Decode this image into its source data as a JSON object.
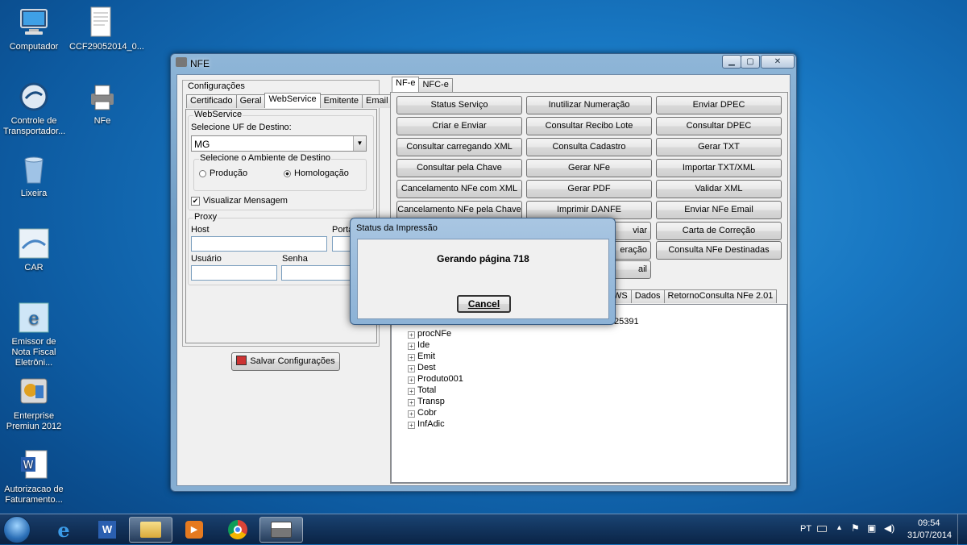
{
  "desktop": {
    "icons": [
      {
        "label": "Computador",
        "icon": "computer-icon"
      },
      {
        "label": "CCF29052014_0...",
        "icon": "document-icon"
      },
      {
        "label": "Controle de Transportador...",
        "icon": "app-icon"
      },
      {
        "label": "NFe",
        "icon": "printer-icon"
      },
      {
        "label": "Lixeira",
        "icon": "recycle-bin-icon"
      },
      {
        "label": "CAR",
        "icon": "car-app-icon"
      },
      {
        "label": "Emissor de Nota Fiscal Eletrôni...",
        "icon": "nfe-emissor-icon"
      },
      {
        "label": "Enterprise Premiun 2012",
        "icon": "enterprise-icon"
      },
      {
        "label": "Autorizacao de Faturamento...",
        "icon": "word-document-icon"
      }
    ]
  },
  "window": {
    "title": "NFE",
    "left": {
      "group_label": "Configurações",
      "tabs": [
        "Certificado",
        "Geral",
        "WebService",
        "Emitente",
        "Email"
      ],
      "active_tab": "WebService",
      "webservice": {
        "legend": "WebService",
        "uf_label": "Selecione UF de Destino:",
        "uf_value": "MG",
        "ambiente_legend": "Selecione o Ambiente de Destino",
        "producao": "Produção",
        "homologacao": "Homologação",
        "selected": "Homologação",
        "visualizar": "Visualizar Mensagem",
        "visualizar_checked": true
      },
      "proxy": {
        "legend": "Proxy",
        "host": "Host",
        "porta": "Porta",
        "usuario": "Usuário",
        "senha": "Senha"
      },
      "save_button": "Salvar Configurações"
    },
    "right": {
      "tabs": [
        "NF-e",
        "NFC-e"
      ],
      "active_tab": "NF-e",
      "buttons": [
        [
          "Status Serviço",
          "Inutilizar Numeração",
          "Enviar DPEC"
        ],
        [
          "Criar e Enviar",
          "Consultar Recibo Lote",
          "Consultar DPEC"
        ],
        [
          "Consultar carregando XML",
          "Consulta Cadastro",
          "Gerar TXT"
        ],
        [
          "Consultar pela Chave",
          "Gerar NFe",
          "Importar TXT/XML"
        ],
        [
          "Cancelamento NFe com XML",
          "Gerar PDF",
          "Validar XML"
        ],
        [
          "Cancelamento NFe pela Chave",
          "Imprimir DANFE",
          "Enviar NFe Email"
        ],
        [
          "",
          "viar",
          "Carta de Correção"
        ],
        [
          "",
          "eração",
          "Consulta NFe Destinadas"
        ],
        [
          "",
          "ail",
          ""
        ]
      ],
      "result_tabs": [
        "WS",
        "Dados",
        "RetornoConsulta NFe 2.01"
      ],
      "partial_number": "25391",
      "tree": [
        "procNFe",
        "Ide",
        "Emit",
        "Dest",
        "Produto001",
        "Total",
        "Transp",
        "Cobr",
        "InfAdic"
      ]
    }
  },
  "dialog": {
    "title": "Status da Impressão",
    "message": "Gerando página 718",
    "cancel": "Cancel"
  },
  "taskbar": {
    "lang": "PT",
    "time": "09:54",
    "date": "31/07/2014",
    "items": [
      "start-orb",
      "internet-explorer-icon",
      "word-icon",
      "explorer-folder-icon",
      "media-player-icon",
      "chrome-icon",
      "nfe-printer-icon"
    ]
  }
}
